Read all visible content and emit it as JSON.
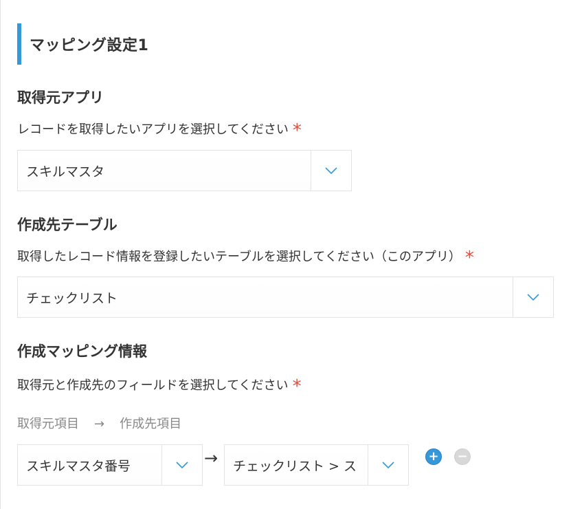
{
  "section": {
    "title": "マッピング設定1"
  },
  "source_app": {
    "label": "取得元アプリ",
    "description": "レコードを取得したいアプリを選択してください",
    "required_mark": "*",
    "selected": "スキルマスタ"
  },
  "target_table": {
    "label": "作成先テーブル",
    "description": "取得したレコード情報を登録したいテーブルを選択してください（このアプリ）",
    "required_mark": "*",
    "selected": "チェックリスト"
  },
  "mapping": {
    "label": "作成マッピング情報",
    "description": "取得元と作成先のフィールドを選択してください",
    "required_mark": "*",
    "caption_source": "取得元項目",
    "caption_arrow": "→",
    "caption_target": "作成先項目",
    "rows": [
      {
        "source": "スキルマスタ番号",
        "arrow": "→",
        "target": "チェックリスト > ス"
      }
    ],
    "add_label": "+",
    "remove_label": "−"
  },
  "colors": {
    "accent": "#3498db",
    "required": "#e74c3c",
    "muted_text": "#888888",
    "border": "#e3e3e3"
  }
}
